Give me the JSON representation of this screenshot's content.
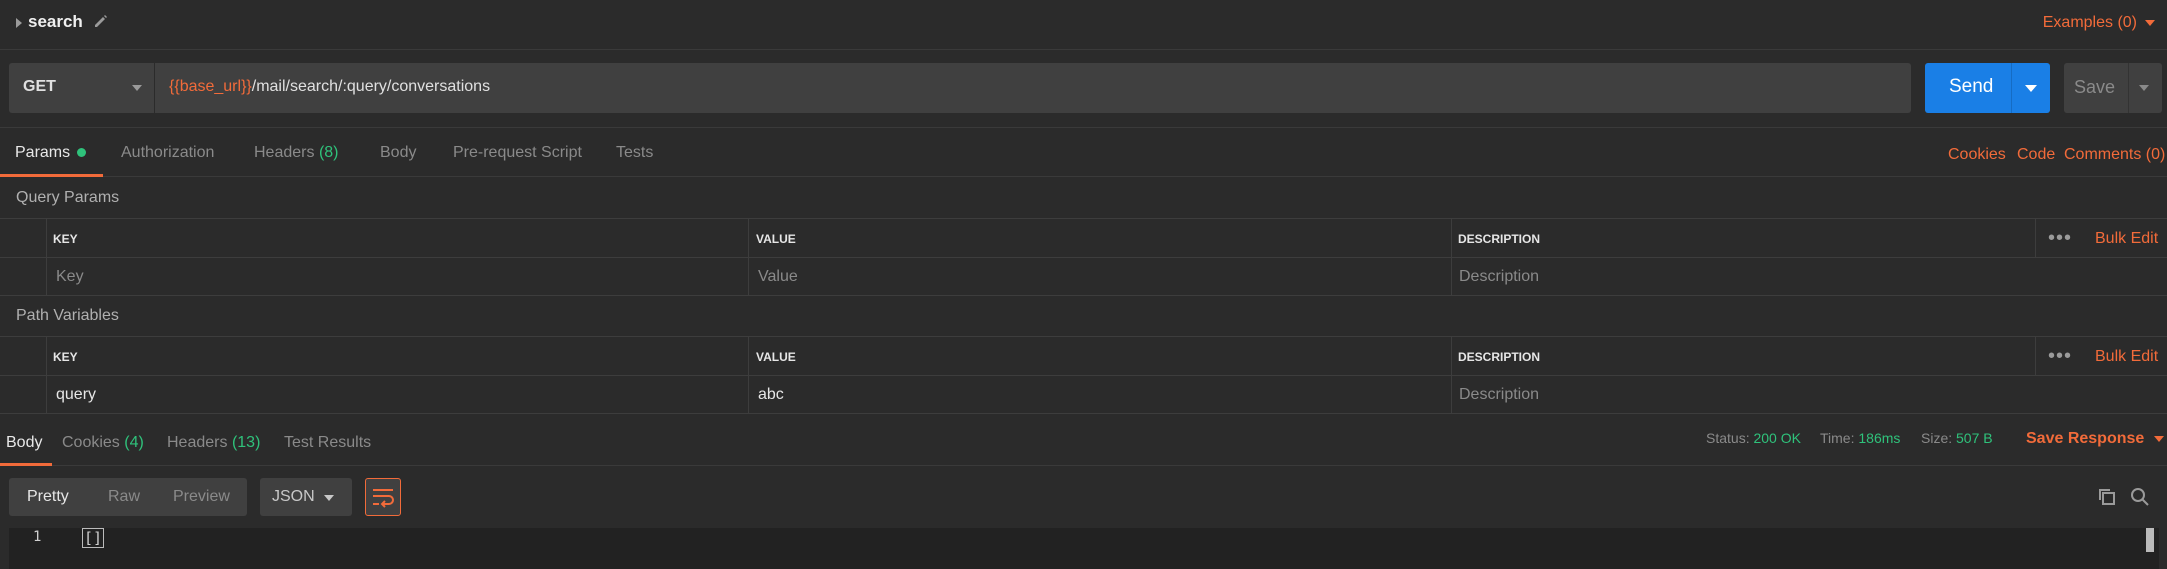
{
  "request": {
    "name": "search",
    "examples_label": "Examples (0)",
    "method": "GET",
    "url_var": "{{base_url}}",
    "url_path": "/mail/search/:query/conversations",
    "send_label": "Send",
    "save_label": "Save"
  },
  "request_tabs": {
    "params": "Params",
    "authorization": "Authorization",
    "headers": "Headers",
    "headers_count": "(8)",
    "body": "Body",
    "prerequest": "Pre-request Script",
    "tests": "Tests",
    "cookies": "Cookies",
    "code": "Code",
    "comments": "Comments (0)"
  },
  "query_params": {
    "title": "Query Params",
    "headers": {
      "key": "KEY",
      "value": "VALUE",
      "description": "DESCRIPTION"
    },
    "bulk_edit": "Bulk Edit",
    "placeholders": {
      "key": "Key",
      "value": "Value",
      "description": "Description"
    }
  },
  "path_variables": {
    "title": "Path Variables",
    "headers": {
      "key": "KEY",
      "value": "VALUE",
      "description": "DESCRIPTION"
    },
    "bulk_edit": "Bulk Edit",
    "row": {
      "key": "query",
      "value": "abc",
      "description_placeholder": "Description"
    }
  },
  "response": {
    "tabs": {
      "body": "Body",
      "cookies": "Cookies",
      "cookies_count": "(4)",
      "headers": "Headers",
      "headers_count": "(13)",
      "test_results": "Test Results"
    },
    "status_label": "Status:",
    "status_value": "200 OK",
    "time_label": "Time:",
    "time_value": "186ms",
    "size_label": "Size:",
    "size_value": "507 B",
    "save_response": "Save Response",
    "view_modes": {
      "pretty": "Pretty",
      "raw": "Raw",
      "preview": "Preview"
    },
    "format": "JSON",
    "line_number": "1",
    "body_text": "[]"
  },
  "colors": {
    "accent": "#f26b3a",
    "primary": "#1a7fe6",
    "success": "#2fc27b",
    "background": "#2b2b2b"
  },
  "icons": [
    "caret-right-icon",
    "pencil-icon",
    "chevron-down-icon",
    "dots-icon",
    "wrap-lines-icon",
    "copy-icon",
    "search-icon"
  ]
}
